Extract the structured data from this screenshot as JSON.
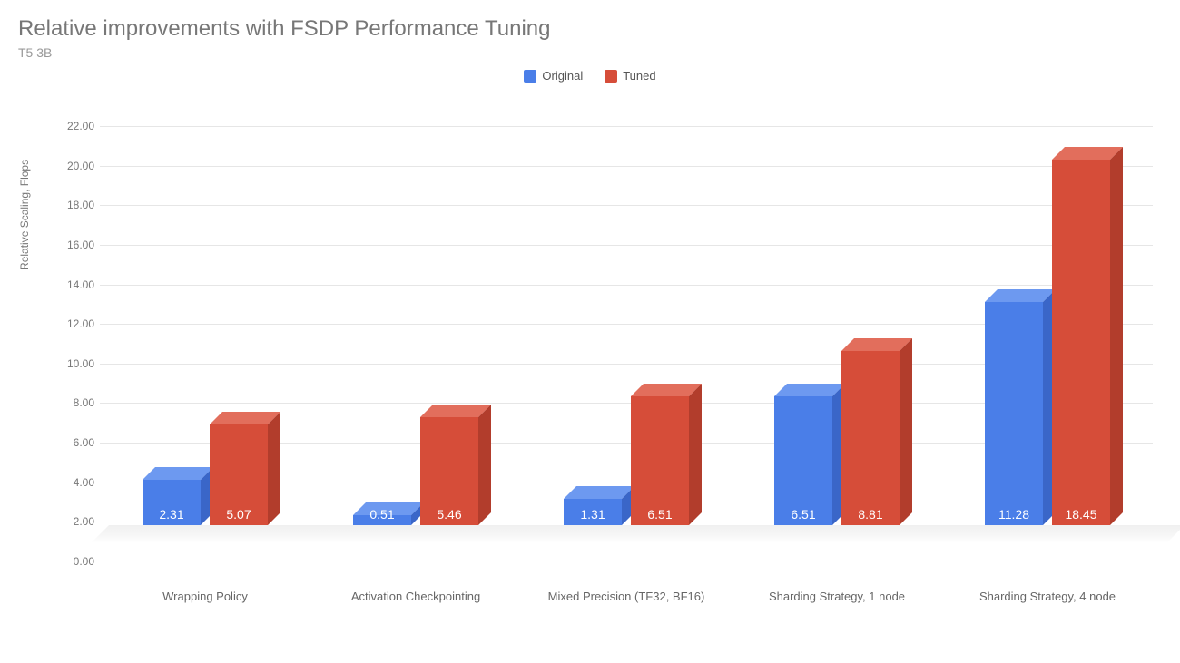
{
  "chart_data": {
    "type": "bar",
    "title": "Relative improvements with FSDP Performance Tuning",
    "subtitle": "T5 3B",
    "xlabel": "",
    "ylabel": "Relative Scaling, Flops",
    "ylim": [
      0,
      22
    ],
    "ytick_step": 2,
    "categories": [
      "Wrapping Policy",
      "Activation Checkpointing",
      "Mixed Precision (TF32, BF16)",
      "Sharding Strategy, 1 node",
      "Sharding Strategy, 4 node"
    ],
    "series": [
      {
        "name": "Original",
        "color": "#4a7ee8",
        "color_top": "#6d99f0",
        "color_side": "#3a66c8",
        "values": [
          2.31,
          0.51,
          1.31,
          6.51,
          11.28
        ]
      },
      {
        "name": "Tuned",
        "color": "#d64d39",
        "color_top": "#e26e5c",
        "color_side": "#b23d2c",
        "values": [
          5.07,
          5.46,
          6.51,
          8.81,
          18.45
        ]
      }
    ],
    "yticks": [
      "0.00",
      "2.00",
      "4.00",
      "6.00",
      "8.00",
      "10.00",
      "12.00",
      "14.00",
      "16.00",
      "18.00",
      "20.00",
      "22.00"
    ]
  }
}
